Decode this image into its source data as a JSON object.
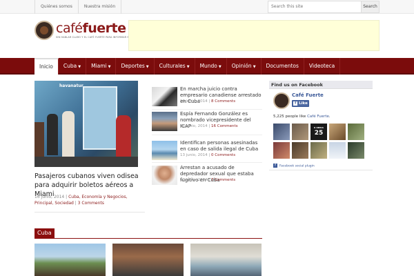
{
  "topbar": {
    "links": [
      "Quiénes somos",
      "Nuestra misión"
    ],
    "search_placeholder": "Search this site",
    "search_button": "Search"
  },
  "logo": {
    "word_light": "café",
    "word_bold": "fuerte",
    "tagline": "SIN HABLAR CLARO Y EL CAFÉ FUERTE PARA INFORMAR SI NO"
  },
  "nav": {
    "items": [
      {
        "label": "Inicio",
        "caret": false,
        "active": true
      },
      {
        "label": "Cuba",
        "caret": true
      },
      {
        "label": "Miami",
        "caret": true
      },
      {
        "label": "Deportes",
        "caret": true
      },
      {
        "label": "Culturales",
        "caret": true
      },
      {
        "label": "Mundo",
        "caret": true
      },
      {
        "label": "Opinión",
        "caret": true
      },
      {
        "label": "Documentos",
        "caret": false
      },
      {
        "label": "Videoteca",
        "caret": false
      }
    ]
  },
  "featured": {
    "image_sign": "havanatur",
    "title": "Pasajeros cubanos viven odisea para adquirir boletos aéreos a Miami",
    "date": "16 junio, 2014",
    "categories": "Cuba, Economía y Negocios, Principal, Sociedad",
    "comments": "3 Comments"
  },
  "news": [
    {
      "title": "En marcha juicio contra empresario canadiense arrestado en Cuba",
      "date": "16 junio, 2014",
      "comments": "8 Comments"
    },
    {
      "title": "Espía Fernando González es nombrado vicepresidente del ICAP",
      "date": "15 junio, 2014",
      "comments": "16 Comments"
    },
    {
      "title": "Identifican personas asesinadas en caso de salida ilegal de Cuba",
      "date": "13 junio, 2014",
      "comments": "0 Comments"
    },
    {
      "title": "Arrestan a acusado de depredador sexual que estaba fugitivo en Cuba",
      "date": "13 junio, 2014",
      "comments": "7 Comments"
    }
  ],
  "facebook": {
    "header": "Find us on Facebook",
    "page_name": "Café Fuerte",
    "like_label": "Like",
    "count_text": "5,225 people like",
    "count_link": "Café Fuerte",
    "plugin_text": "Facebook social plugin",
    "avatar_badge": "25",
    "avatar_top_text": "K OBRIA"
  },
  "section": {
    "label": "Cuba"
  },
  "colors": {
    "brand": "#7b0c0c",
    "facebook": "#3b5998",
    "ad_bg": "#ffffd8"
  }
}
